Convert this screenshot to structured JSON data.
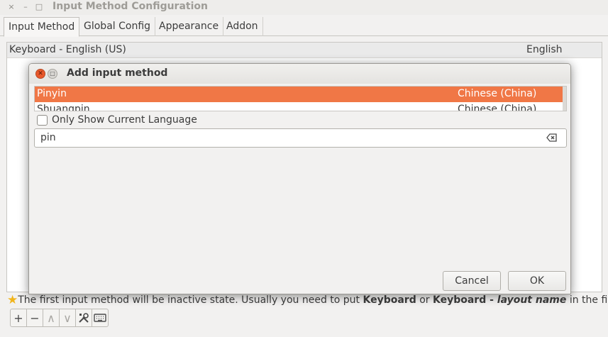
{
  "window": {
    "title": "Input Method Configuration",
    "close_glyph": "×",
    "minimize_glyph": "–",
    "maximize_glyph": "□"
  },
  "tabs": [
    {
      "label": "Input Method"
    },
    {
      "label": "Global Config"
    },
    {
      "label": "Appearance"
    },
    {
      "label": "Addon"
    }
  ],
  "input_methods": [
    {
      "name": "Keyboard - English (US)",
      "language": "English"
    }
  ],
  "hint": {
    "prefix": "The first input method will be inactive state. Usually you need to put ",
    "keyword1": "Keyboard",
    "middle": " or ",
    "keyword2": "Keyboard - ",
    "keyword3": "layout name",
    "suffix": " in the first place."
  },
  "toolbar": {
    "add": "+",
    "remove": "−",
    "up": "∧",
    "down": "∨",
    "configure_icon": "tools-icon",
    "keyboard_icon": "keyboard-icon"
  },
  "dialog": {
    "title": "Add input method",
    "results": [
      {
        "name": "Pinyin",
        "language": "Chinese (China)"
      },
      {
        "name": "Shuangpin",
        "language": "Chinese (China)"
      }
    ],
    "only_current_language": "Only Show Current Language",
    "search_value": "pin",
    "cancel": "Cancel",
    "ok": "OK"
  },
  "colors": {
    "selection": "#f07746",
    "close_button": "#e9582b",
    "hint_star": "#f1b51c"
  }
}
